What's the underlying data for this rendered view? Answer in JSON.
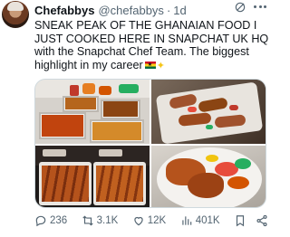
{
  "author": {
    "name": "Chefabbys",
    "handle": "@chefabbys",
    "separator": "·",
    "time": "1d"
  },
  "tweet": {
    "lines": [
      "SNEAK PEAK OF THE GHANAIAN FOOD I",
      "JUST COOKED HERE IN SNAPCHAT UK HQ",
      "with the Snapchat Chef Team. The biggest",
      "highlight in my career"
    ],
    "emoji": [
      "ghana-flag",
      "sparkles"
    ]
  },
  "media": {
    "photos": [
      "buffet-trays-photo",
      "grilled-fish-platter-photo",
      "meat-skewers-trays-photo",
      "chicken-plate-photo"
    ]
  },
  "metrics": {
    "replies": "236",
    "reposts": "3.1K",
    "likes": "12K",
    "views": "401K"
  },
  "icons": {
    "reply": "reply-icon",
    "repost": "repost-icon",
    "like": "like-icon",
    "views": "views-icon",
    "bookmark": "bookmark-icon",
    "share": "share-icon",
    "grok": "grok-icon",
    "more": "more-icon"
  },
  "colors": {
    "text": "#0f1419",
    "secondary": "#536471",
    "border": "#cfd9de"
  }
}
